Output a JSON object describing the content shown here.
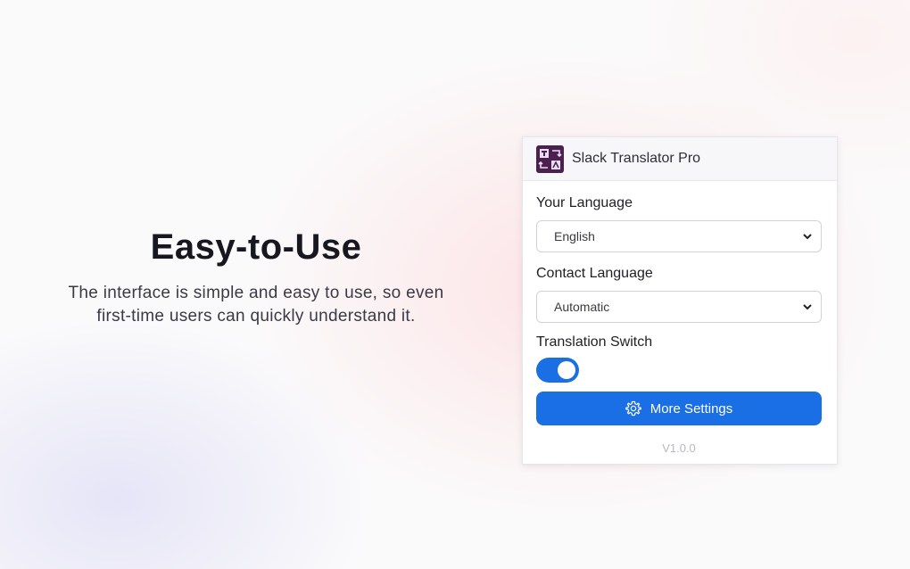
{
  "hero": {
    "title": "Easy-to-Use",
    "description_line1": "The interface is simple and easy to use, so even",
    "description_line2": "first-time users can quickly understand it."
  },
  "popup": {
    "app_name": "Slack Translator Pro",
    "your_language_label": "Your Language",
    "your_language_value": "English",
    "contact_language_label": "Contact Language",
    "contact_language_value": "Automatic",
    "translation_switch_label": "Translation Switch",
    "translation_switch_on": true,
    "more_settings_label": "More Settings",
    "version": "V1.0.0"
  },
  "colors": {
    "accent": "#1b6fe4",
    "logo_bg": "#4b1f4e"
  },
  "icons": {
    "logo": "translator-logo-icon",
    "dropdown": "chevron-down-icon",
    "settings": "gear-icon"
  }
}
